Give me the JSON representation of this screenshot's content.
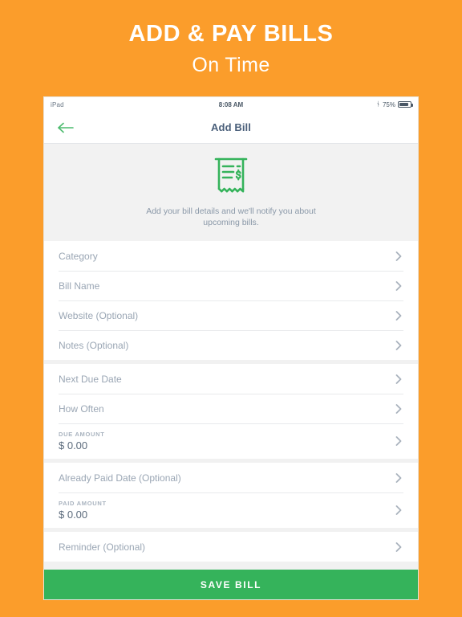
{
  "promo": {
    "title": "ADD & PAY BILLS",
    "subtitle": "On Time",
    "background_color": "#fb9d2b"
  },
  "status_bar": {
    "device": "iPad",
    "time": "8:08 AM",
    "battery_percent": "75%",
    "bluetooth_icon": "bluetooth-icon",
    "battery_icon": "battery-icon"
  },
  "nav": {
    "back_icon": "arrow-left-icon",
    "title": "Add Bill",
    "accent_color": "#35b35b",
    "title_color": "#4a5f7a"
  },
  "hero": {
    "icon": "receipt-icon",
    "icon_color": "#35b35b",
    "text": "Add your bill details and we'll notify you about upcoming bills."
  },
  "form_groups": [
    {
      "rows": [
        {
          "label": "Category",
          "type": "label",
          "chevron": "chevron-right-icon"
        },
        {
          "label": "Bill Name",
          "type": "label",
          "chevron": "chevron-right-icon"
        },
        {
          "label": "Website (Optional)",
          "type": "label",
          "chevron": "chevron-right-icon"
        },
        {
          "label": "Notes (Optional)",
          "type": "label",
          "chevron": "chevron-right-icon"
        }
      ]
    },
    {
      "rows": [
        {
          "label": "Next Due Date",
          "type": "label",
          "chevron": "chevron-right-icon"
        },
        {
          "label": "How Often",
          "type": "label",
          "chevron": "chevron-right-icon"
        },
        {
          "caption": "DUE AMOUNT",
          "value": "$ 0.00",
          "type": "amount",
          "chevron": "chevron-right-icon"
        }
      ]
    },
    {
      "rows": [
        {
          "label": "Already Paid Date (Optional)",
          "type": "label",
          "chevron": "chevron-right-icon"
        },
        {
          "caption": "PAID AMOUNT",
          "value": "$ 0.00",
          "type": "amount",
          "chevron": "chevron-right-icon"
        }
      ]
    },
    {
      "rows": [
        {
          "label": "Reminder (Optional)",
          "type": "label",
          "chevron": "chevron-right-icon"
        }
      ]
    }
  ],
  "save_button": {
    "label": "SAVE BILL",
    "color": "#35b35b"
  }
}
